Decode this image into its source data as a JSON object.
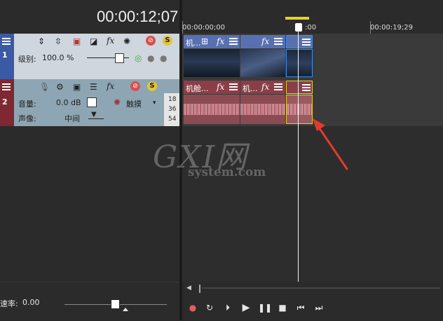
{
  "timecode": "00:00:12;07",
  "ruler": {
    "labels": [
      "00:00:00;00",
      ":00",
      "00:00:19;29"
    ]
  },
  "video_track": {
    "number": "1",
    "level_label": "级别:",
    "level_value": "100.0 %",
    "clips": [
      {
        "title": "机..."
      },
      {
        "title": ""
      },
      {
        "title": ""
      }
    ]
  },
  "audio_track": {
    "number": "2",
    "volume_label": "音量:",
    "volume_value": "0.0 dB",
    "pan_label": "声像:",
    "pan_value": "中间",
    "touch_label": "触摸",
    "db_ticks": [
      "18",
      "36",
      "54"
    ],
    "clips": [
      {
        "title": "机舱..."
      },
      {
        "title": "机..."
      },
      {
        "title": ""
      }
    ]
  },
  "rate": {
    "label": "速率:",
    "value": "0.00"
  },
  "watermark": {
    "main": "GXI网",
    "sub": "system.com"
  },
  "colors": {
    "accent_yellow": "#e6d21e",
    "clip_blue": "#5870b0",
    "clip_red": "#8a3f48",
    "arrow_red": "#e33a2f"
  },
  "icons": [
    "menu-icon",
    "fx-icon",
    "record-icon",
    "loop-icon",
    "play-from-start-icon",
    "play-icon",
    "pause-icon",
    "stop-icon",
    "prev-frame-icon",
    "next-frame-icon"
  ]
}
